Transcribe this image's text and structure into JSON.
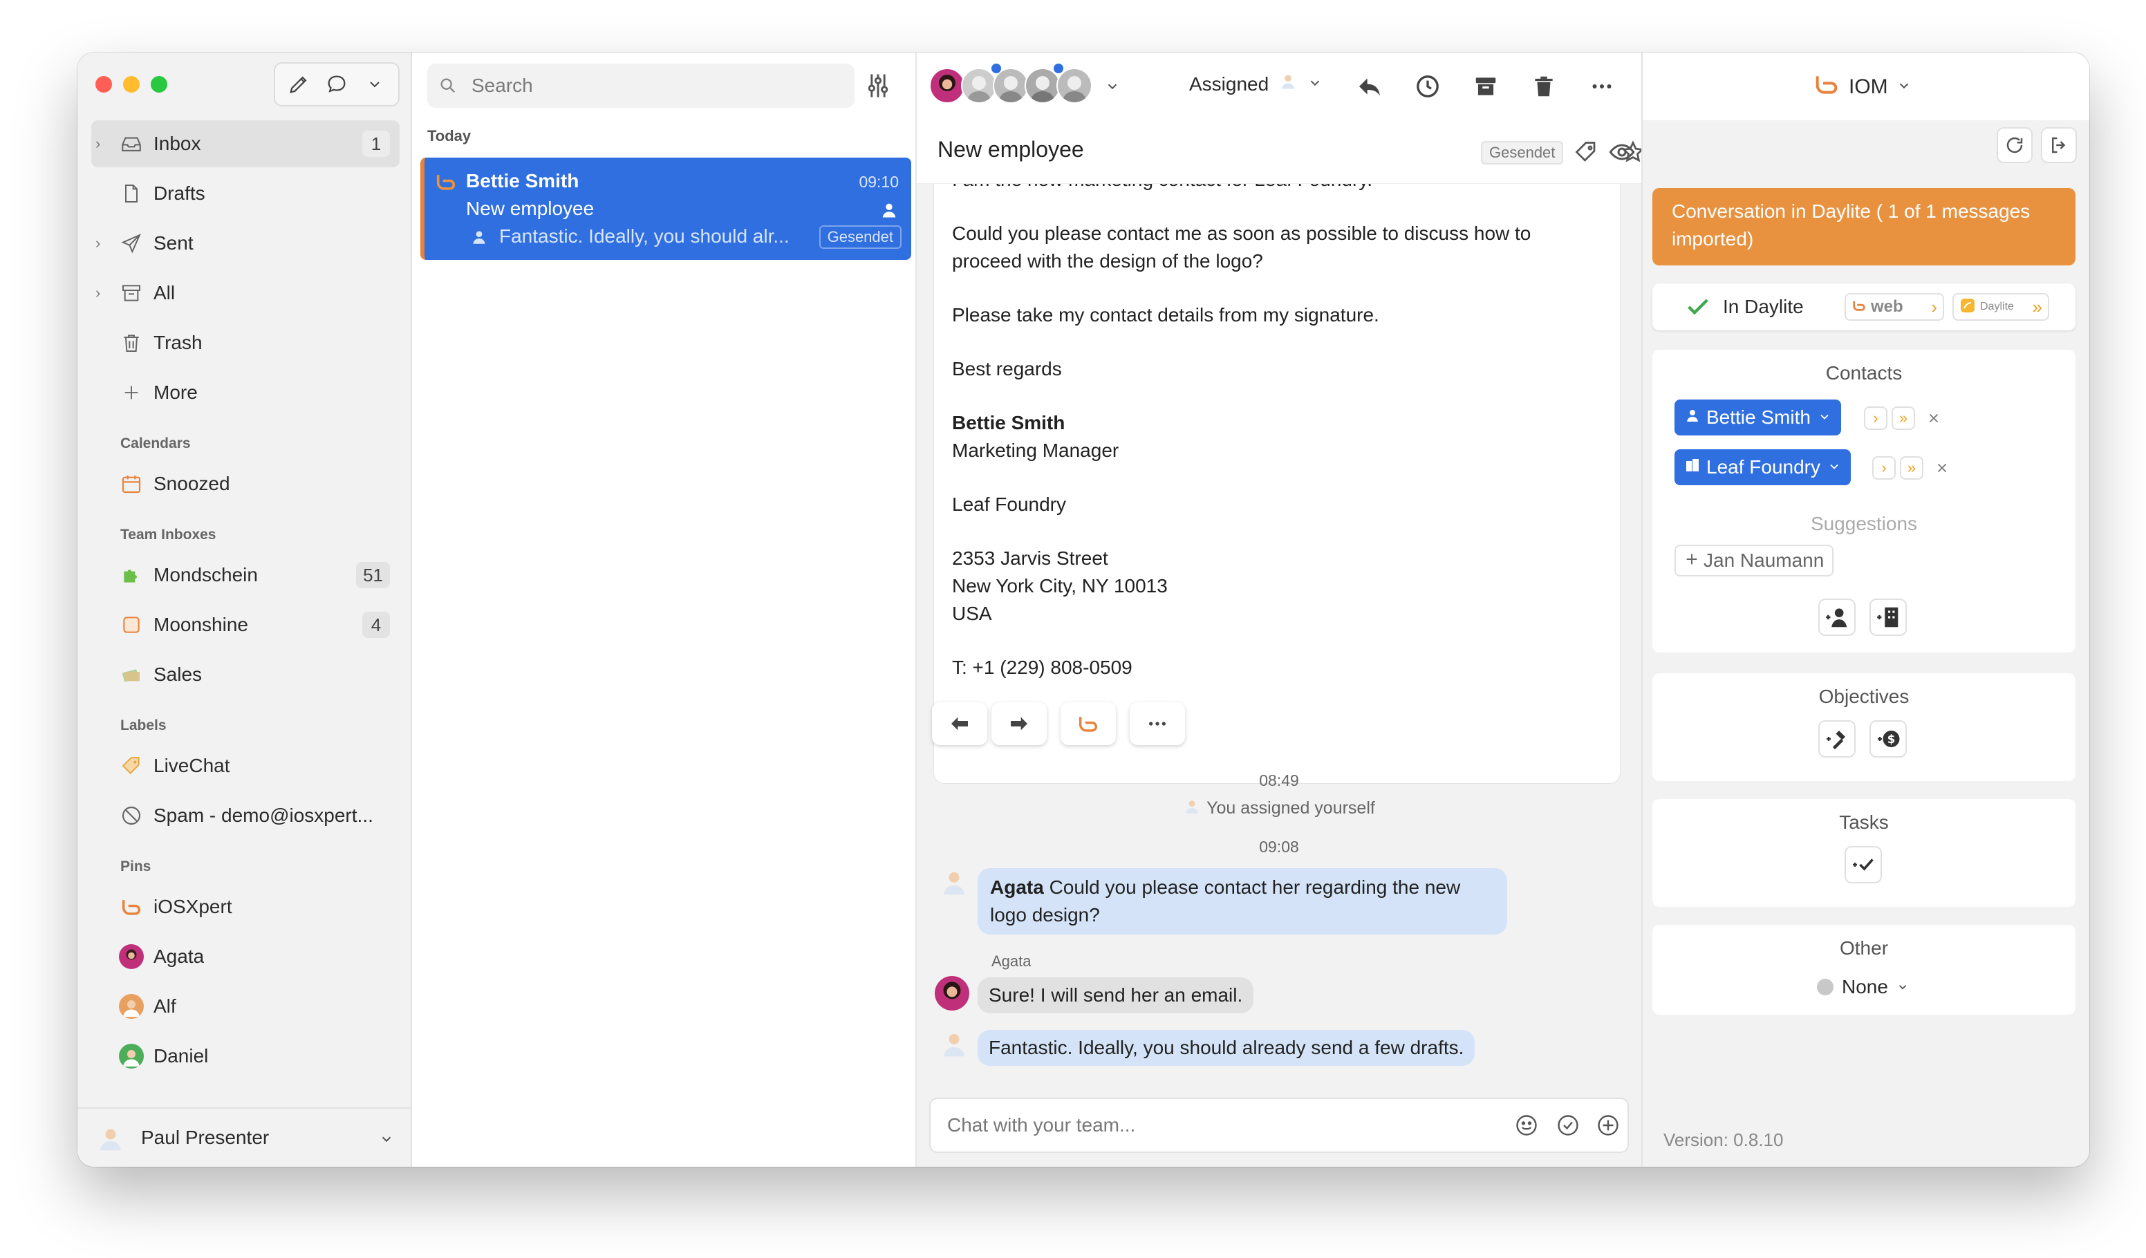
{
  "colors": {
    "accent_blue": "#2f6fe0",
    "orange": "#e8823a",
    "chat_bubble_blue": "#d4e3f7",
    "traffic_red": "#ff5f57",
    "traffic_yellow": "#febc2e",
    "traffic_green": "#28c840"
  },
  "sidebar": {
    "items": [
      {
        "label": "Inbox",
        "count": "1",
        "icon": "inbox-icon"
      },
      {
        "label": "Drafts",
        "icon": "draft-icon"
      },
      {
        "label": "Sent",
        "icon": "sent-icon"
      },
      {
        "label": "All",
        "icon": "archive-box-icon"
      },
      {
        "label": "Trash",
        "icon": "trash-icon"
      },
      {
        "label": "More",
        "icon": "plus-icon"
      }
    ],
    "calendars_heading": "Calendars",
    "calendars": [
      {
        "label": "Snoozed",
        "icon": "calendar-icon"
      }
    ],
    "team_heading": "Team Inboxes",
    "team_inboxes": [
      {
        "label": "Mondschein",
        "count": "51",
        "icon": "puzzle-icon"
      },
      {
        "label": "Moonshine",
        "count": "4",
        "icon": "square-icon"
      },
      {
        "label": "Sales",
        "icon": "money-icon"
      }
    ],
    "labels_heading": "Labels",
    "labels": [
      {
        "label": "LiveChat",
        "icon": "tag-icon"
      },
      {
        "label": "Spam - demo@iosxpert...",
        "icon": "block-icon"
      }
    ],
    "pins_heading": "Pins",
    "pins": [
      {
        "label": "iOSXpert",
        "icon": "iosxpert-logo-icon"
      },
      {
        "label": "Agata",
        "icon": "avatar-icon"
      },
      {
        "label": "Alf",
        "icon": "avatar-icon"
      },
      {
        "label": "Daniel",
        "icon": "avatar-icon"
      }
    ],
    "footer_user": "Paul Presenter"
  },
  "list": {
    "search_placeholder": "Search",
    "group_label": "Today",
    "message": {
      "sender": "Bettie Smith",
      "time": "09:10",
      "subject": "New employee",
      "preview": "Fantastic. Ideally, you should alr...",
      "badge": "Gesendet"
    }
  },
  "toolbar": {
    "assigned_label": "Assigned",
    "account_label": "IOM"
  },
  "conversation": {
    "title": "New employee",
    "badge": "Gesendet",
    "email_lines": {
      "cut_line": "I am the new marketing contact for Leaf Foundry.",
      "p1": "Could you please contact me as soon as possible to discuss how to proceed with the design of the logo?",
      "p2": "Please take my contact details from my signature.",
      "p3": "Best regards",
      "sig_name": "Bettie Smith",
      "sig_title": "Marketing Manager",
      "sig_company": "Leaf Foundry",
      "addr1": "2353 Jarvis Street",
      "addr2": "New York City, NY 10013",
      "addr3": "USA",
      "phone": "T: +1 (229) 808-0509"
    },
    "chat": {
      "time1": "08:49",
      "event": "You assigned yourself",
      "time2": "09:08",
      "msg1_author": "Agata",
      "msg1_text": " Could you please contact her regarding the new logo design?",
      "msg2_author": "Agata",
      "msg2_text": "Sure! I will send her an email.",
      "msg3_text": "Fantastic. Ideally, you should already send a few drafts."
    },
    "chat_placeholder": "Chat with your team..."
  },
  "right": {
    "banner": "Conversation in Daylite ( 1 of 1 messages imported)",
    "in_daylite": "In Daylite",
    "web_badge": "web",
    "daylite_badge": "Daylite",
    "contacts_title": "Contacts",
    "contact1": "Bettie Smith",
    "contact2": "Leaf Foundry",
    "suggestions_title": "Suggestions",
    "suggestion1": "Jan Naumann",
    "objectives_title": "Objectives",
    "tasks_title": "Tasks",
    "other_title": "Other",
    "other_value": "None",
    "version": "Version: 0.8.10"
  }
}
